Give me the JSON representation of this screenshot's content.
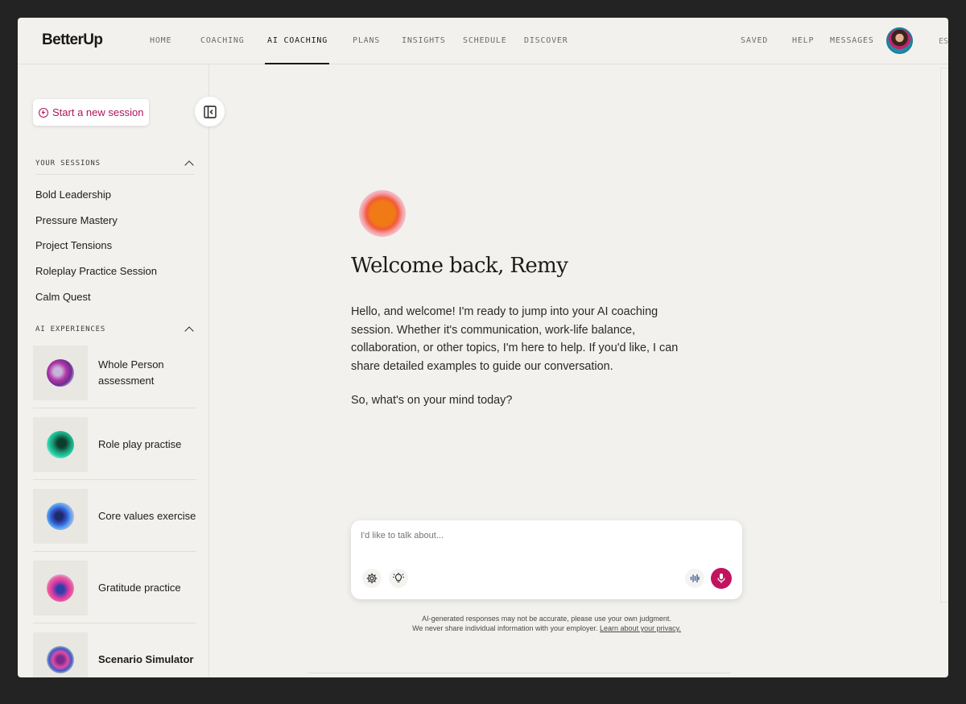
{
  "app": {
    "logo": "BetterUp"
  },
  "nav": {
    "left": [
      "HOME",
      "COACHING",
      "AI COACHING",
      "PLANS",
      "INSIGHTS",
      "SCHEDULE",
      "DISCOVER"
    ],
    "active": "AI COACHING",
    "right": [
      "SAVED",
      "HELP",
      "MESSAGES"
    ],
    "clipped": "ES"
  },
  "sidebar": {
    "new_session_label": "Start a new session",
    "sessions_heading": "YOUR SESSIONS",
    "sessions": [
      "Bold Leadership",
      "Pressure Mastery",
      "Project Tensions",
      "Roleplay Practice Session",
      "Calm Quest"
    ],
    "experiences_heading": "AI EXPERIENCES",
    "experiences": [
      {
        "label": "Whole Person assessment",
        "icon": "whole-person-orb-icon"
      },
      {
        "label": "Role play practise",
        "icon": "role-play-orb-icon"
      },
      {
        "label": "Core values exercise",
        "icon": "core-values-orb-icon"
      },
      {
        "label": "Gratitude practice",
        "icon": "gratitude-orb-icon"
      },
      {
        "label": "Scenario Simulator",
        "icon": "scenario-orb-icon"
      }
    ]
  },
  "main": {
    "welcome": "Welcome back, Remy",
    "intro": "Hello, and welcome! I'm ready to jump into your AI coaching session. Whether it's communication, work-life balance, collaboration, or other topics, I'm here to help. If you'd like, I can share detailed examples to guide our conversation.",
    "prompt": "So, what's on your mind today?",
    "composer": {
      "placeholder": "I'd like to talk about..."
    },
    "disclaimer_line1": "AI-generated responses may not be accurate, please use your own judgment.",
    "disclaimer_line2": "We never share individual information with your employer.",
    "privacy_link": "Learn about your privacy."
  },
  "colors": {
    "accent": "#c2135f",
    "background": "#f2f1ee",
    "frame": "#242323"
  }
}
